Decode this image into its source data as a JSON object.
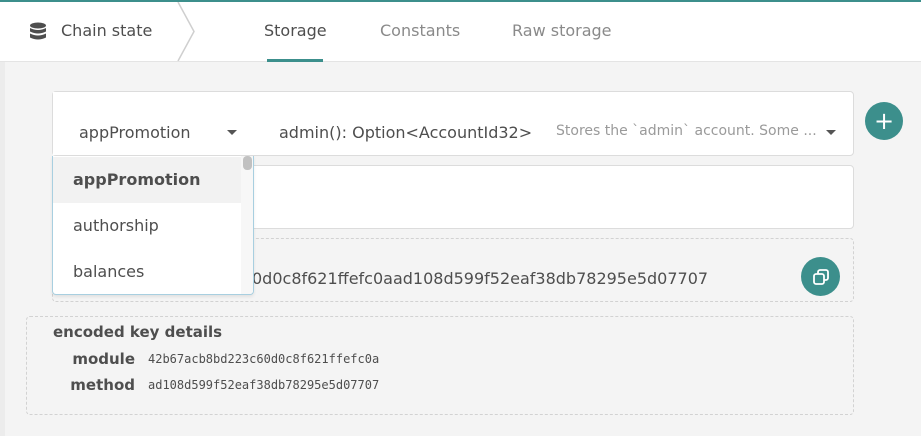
{
  "header": {
    "breadcrumb_label": "Chain state",
    "breadcrumb_icon": "database-icon",
    "tabs": [
      {
        "label": "Storage",
        "active": true
      },
      {
        "label": "Constants",
        "active": false
      },
      {
        "label": "Raw storage",
        "active": false
      }
    ]
  },
  "selector": {
    "module": "appPromotion",
    "method": "admin(): Option<AccountId32>",
    "doc": "Stores the `admin` account. Some ..."
  },
  "module_dropdown": {
    "options": [
      "appPromotion",
      "authorship",
      "balances"
    ],
    "selected": "appPromotion"
  },
  "result": {
    "value": "0d0c8f621ffefc0aad108d599f52eaf38db78295e5d07707"
  },
  "encoded_key": {
    "title": "encoded key details",
    "module_label": "module",
    "module_value": "42b67acb8bd223c60d0c8f621ffefc0a",
    "method_label": "method",
    "method_value": "ad108d599f52eaf38db78295e5d07707"
  },
  "colors": {
    "accent": "#3c8f8c",
    "background": "#f4f4f4"
  }
}
